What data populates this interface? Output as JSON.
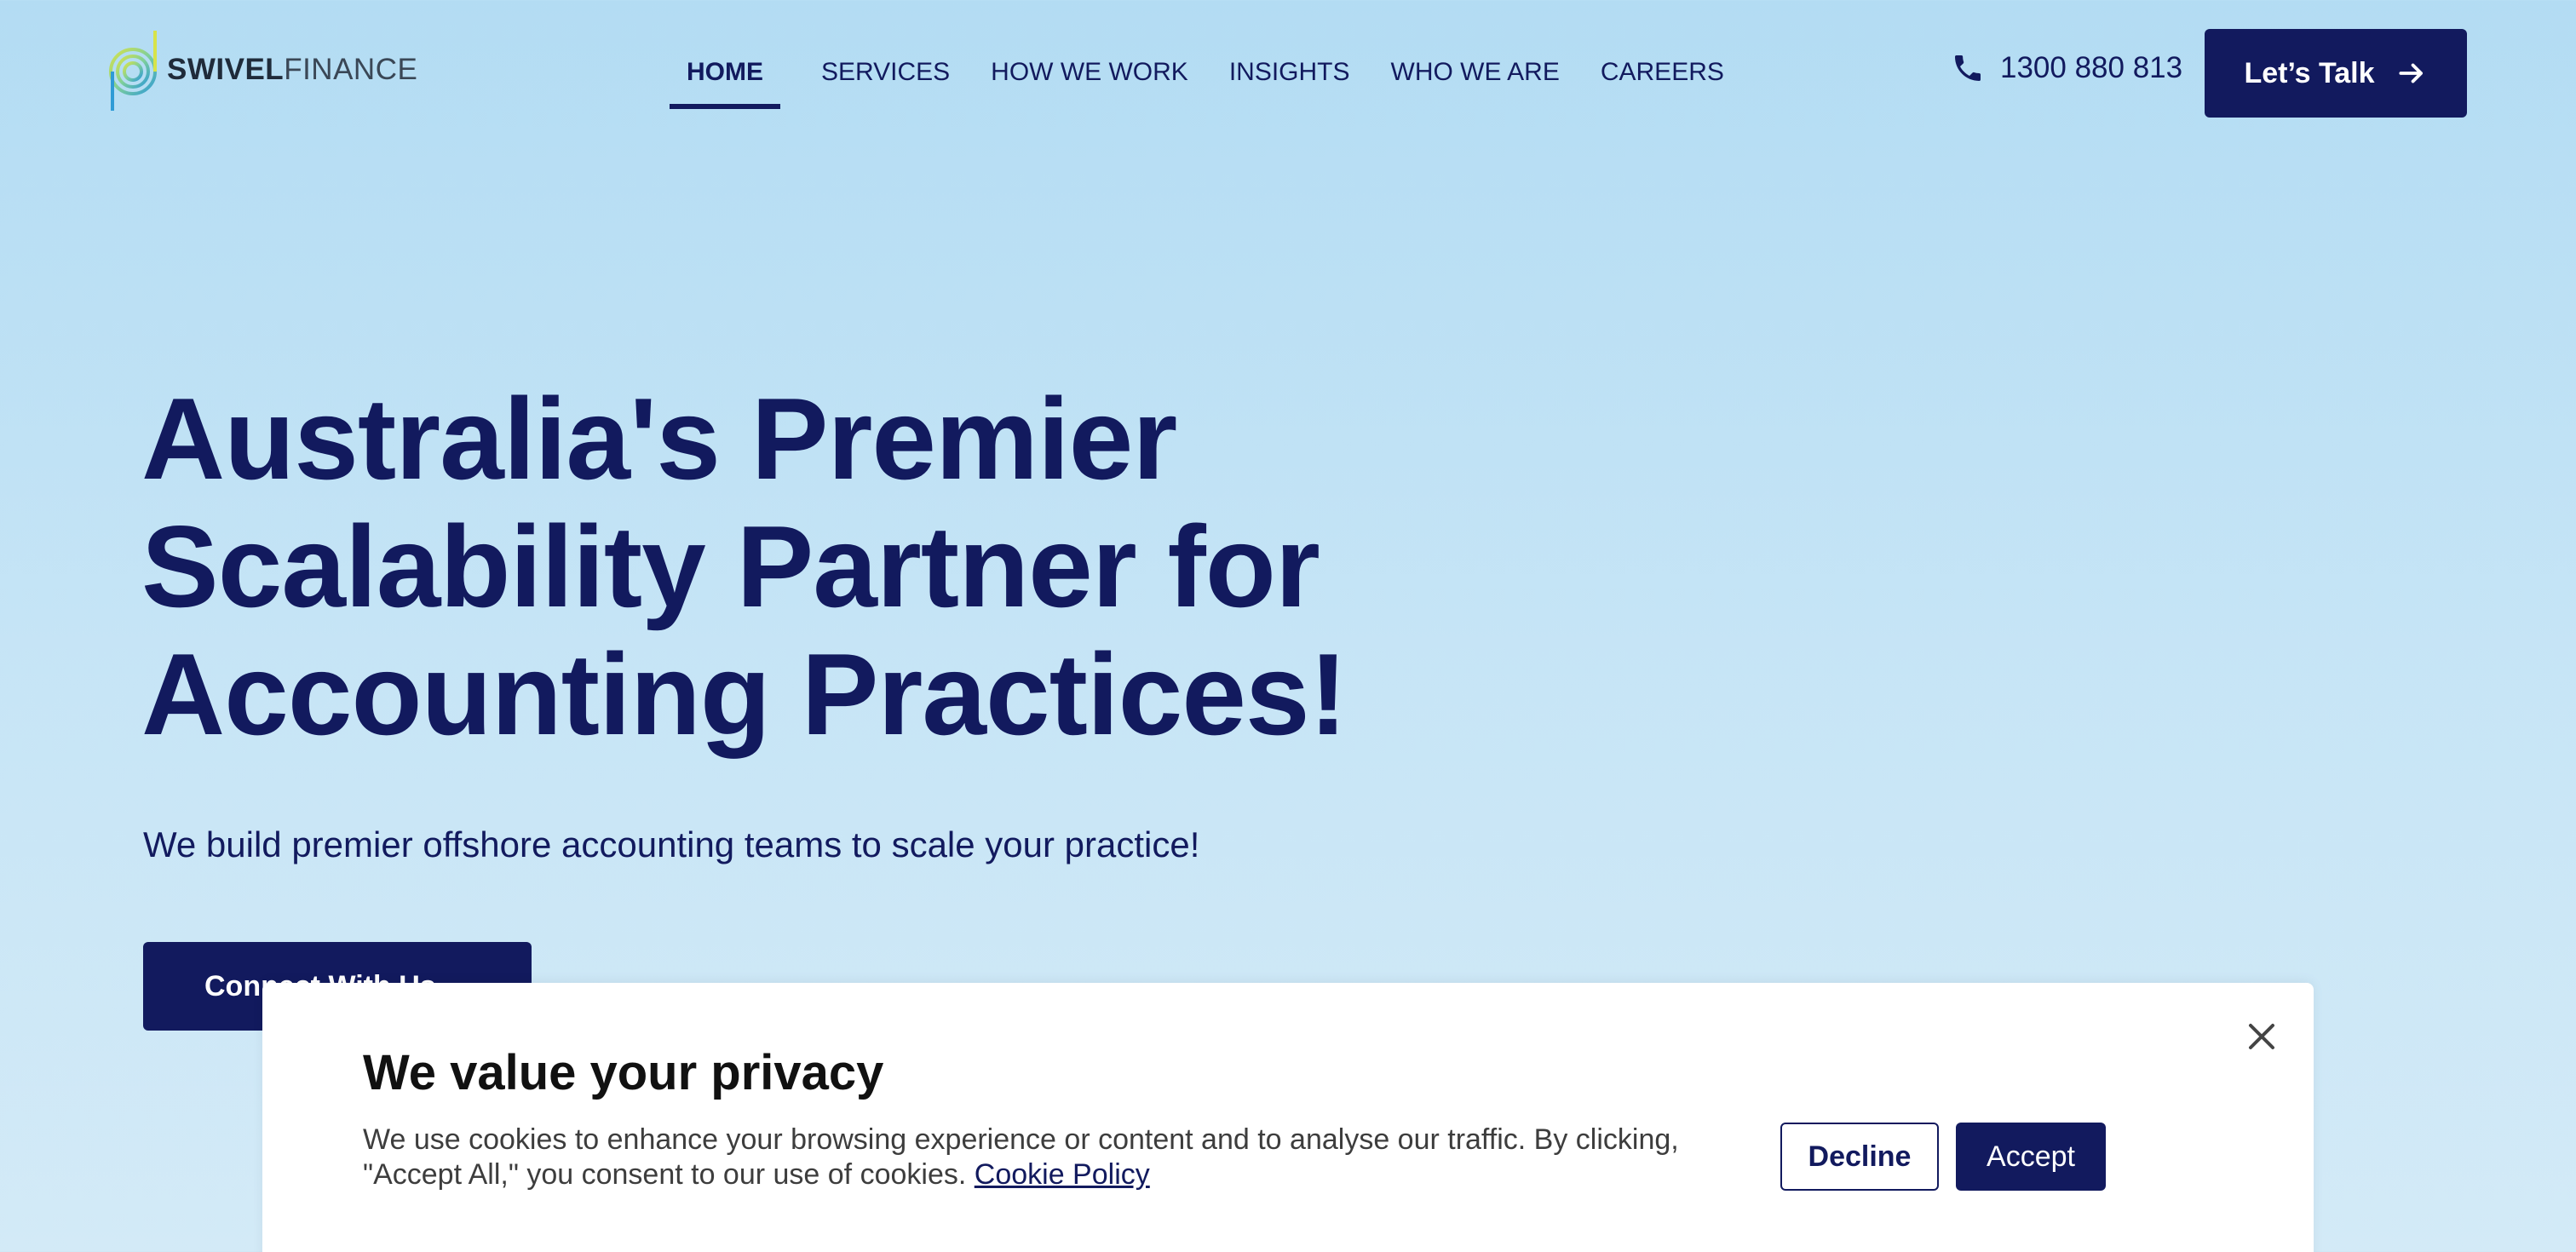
{
  "header": {
    "logo": {
      "bold": "SWIVEL",
      "light": "FINANCE"
    },
    "nav": [
      {
        "label": "HOME",
        "active": true
      },
      {
        "label": "SERVICES"
      },
      {
        "label": "HOW WE WORK"
      },
      {
        "label": "INSIGHTS"
      },
      {
        "label": "WHO WE ARE"
      },
      {
        "label": "CAREERS"
      }
    ],
    "phone": "1300 880 813",
    "cta_label": "Let’s Talk"
  },
  "hero": {
    "title_lines": [
      "Australia's Premier",
      "Scalability Partner for",
      "Accounting Practices!"
    ],
    "subtitle": "We build premier offshore accounting teams to scale your practice!",
    "button_label": "Connect With Us"
  },
  "cookie": {
    "title": "We value your privacy",
    "text": "We use cookies to enhance your browsing experience or content and to analyse our traffic. By clicking, \"Accept All,\" you consent to our use of cookies.",
    "link": "Cookie Policy",
    "decline": "Decline",
    "accept": "Accept"
  },
  "icons": {
    "phone": "phone-icon",
    "arrow": "arrow-right-icon",
    "close": "close-icon"
  },
  "colors": {
    "navy": "#121a5e",
    "background_top": "#b3dcf3",
    "background_bottom": "#d3eaf7"
  }
}
